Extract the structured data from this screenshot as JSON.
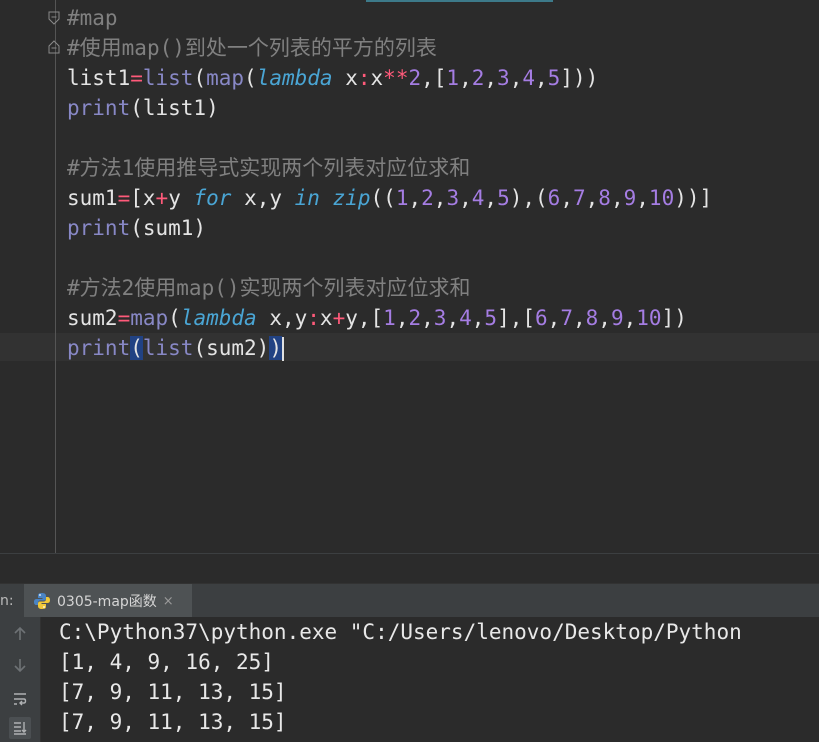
{
  "editor": {
    "code_lines": [
      [
        {
          "t": "#map",
          "c": "comment"
        }
      ],
      [
        {
          "t": "#使用",
          "c": "comment"
        },
        {
          "t": "map()",
          "c": "comment"
        },
        {
          "t": "到处一个列表的平方的列表",
          "c": "comment"
        }
      ],
      [
        {
          "t": "list1",
          "c": "plain"
        },
        {
          "t": "=",
          "c": "op"
        },
        {
          "t": "list",
          "c": "fn"
        },
        {
          "t": "(",
          "c": "plain"
        },
        {
          "t": "map",
          "c": "fn"
        },
        {
          "t": "(",
          "c": "plain"
        },
        {
          "t": "lambda",
          "c": "italic"
        },
        {
          "t": " x",
          "c": "plain"
        },
        {
          "t": ":",
          "c": "op"
        },
        {
          "t": "x",
          "c": "plain"
        },
        {
          "t": "**",
          "c": "op"
        },
        {
          "t": "2",
          "c": "num"
        },
        {
          "t": ",[",
          "c": "plain"
        },
        {
          "t": "1",
          "c": "num"
        },
        {
          "t": ",",
          "c": "plain"
        },
        {
          "t": "2",
          "c": "num"
        },
        {
          "t": ",",
          "c": "plain"
        },
        {
          "t": "3",
          "c": "num"
        },
        {
          "t": ",",
          "c": "plain"
        },
        {
          "t": "4",
          "c": "num"
        },
        {
          "t": ",",
          "c": "plain"
        },
        {
          "t": "5",
          "c": "num"
        },
        {
          "t": "]))",
          "c": "plain"
        }
      ],
      [
        {
          "t": "print",
          "c": "fn"
        },
        {
          "t": "(list1)",
          "c": "plain"
        }
      ],
      [],
      [
        {
          "t": "#方法1使用推导式实现两个列表对应位求和",
          "c": "comment"
        }
      ],
      [
        {
          "t": "sum1",
          "c": "plain"
        },
        {
          "t": "=",
          "c": "op"
        },
        {
          "t": "[x",
          "c": "plain"
        },
        {
          "t": "+",
          "c": "op"
        },
        {
          "t": "y ",
          "c": "plain"
        },
        {
          "t": "for",
          "c": "italic"
        },
        {
          "t": " x,y ",
          "c": "plain"
        },
        {
          "t": "in",
          "c": "italic"
        },
        {
          "t": " ",
          "c": "plain"
        },
        {
          "t": "zip",
          "c": "italic"
        },
        {
          "t": "((",
          "c": "plain"
        },
        {
          "t": "1",
          "c": "num"
        },
        {
          "t": ",",
          "c": "plain"
        },
        {
          "t": "2",
          "c": "num"
        },
        {
          "t": ",",
          "c": "plain"
        },
        {
          "t": "3",
          "c": "num"
        },
        {
          "t": ",",
          "c": "plain"
        },
        {
          "t": "4",
          "c": "num"
        },
        {
          "t": ",",
          "c": "plain"
        },
        {
          "t": "5",
          "c": "num"
        },
        {
          "t": "),(",
          "c": "plain"
        },
        {
          "t": "6",
          "c": "num"
        },
        {
          "t": ",",
          "c": "plain"
        },
        {
          "t": "7",
          "c": "num"
        },
        {
          "t": ",",
          "c": "plain"
        },
        {
          "t": "8",
          "c": "num"
        },
        {
          "t": ",",
          "c": "plain"
        },
        {
          "t": "9",
          "c": "num"
        },
        {
          "t": ",",
          "c": "plain"
        },
        {
          "t": "10",
          "c": "num"
        },
        {
          "t": "))]",
          "c": "plain"
        }
      ],
      [
        {
          "t": "print",
          "c": "fn"
        },
        {
          "t": "(sum1)",
          "c": "plain"
        }
      ],
      [],
      [
        {
          "t": "#方法2使用map()实现两个列表对应位求和",
          "c": "comment"
        }
      ],
      [
        {
          "t": "sum2",
          "c": "plain"
        },
        {
          "t": "=",
          "c": "op"
        },
        {
          "t": "map",
          "c": "fn"
        },
        {
          "t": "(",
          "c": "plain"
        },
        {
          "t": "lambda",
          "c": "italic"
        },
        {
          "t": " x,y",
          "c": "plain"
        },
        {
          "t": ":",
          "c": "op"
        },
        {
          "t": "x",
          "c": "plain"
        },
        {
          "t": "+",
          "c": "op"
        },
        {
          "t": "y,[",
          "c": "plain"
        },
        {
          "t": "1",
          "c": "num"
        },
        {
          "t": ",",
          "c": "plain"
        },
        {
          "t": "2",
          "c": "num"
        },
        {
          "t": ",",
          "c": "plain"
        },
        {
          "t": "3",
          "c": "num"
        },
        {
          "t": ",",
          "c": "plain"
        },
        {
          "t": "4",
          "c": "num"
        },
        {
          "t": ",",
          "c": "plain"
        },
        {
          "t": "5",
          "c": "num"
        },
        {
          "t": "],[",
          "c": "plain"
        },
        {
          "t": "6",
          "c": "num"
        },
        {
          "t": ",",
          "c": "plain"
        },
        {
          "t": "7",
          "c": "num"
        },
        {
          "t": ",",
          "c": "plain"
        },
        {
          "t": "8",
          "c": "num"
        },
        {
          "t": ",",
          "c": "plain"
        },
        {
          "t": "9",
          "c": "num"
        },
        {
          "t": ",",
          "c": "plain"
        },
        {
          "t": "10",
          "c": "num"
        },
        {
          "t": "])",
          "c": "plain"
        }
      ],
      [
        {
          "t": "print",
          "c": "fn"
        },
        {
          "t": "(",
          "c": "bracket"
        },
        {
          "t": "list",
          "c": "fn"
        },
        {
          "t": "(sum2)",
          "c": "plain"
        },
        {
          "t": ")",
          "c": "bracket"
        }
      ]
    ]
  },
  "run": {
    "prefix": "n:",
    "tab_label": "0305-map函数",
    "close_glyph": "×",
    "icon": "python-icon",
    "toolbar": [
      "up-arrow-icon",
      "down-arrow-icon",
      "soft-wrap-icon",
      "scroll-to-end-icon"
    ]
  },
  "console": {
    "lines": [
      "C:\\Python37\\python.exe \"C:/Users/lenovo/Desktop/Python",
      "[1, 4, 9, 16, 25]",
      "[7, 9, 11, 13, 15]",
      "[7, 9, 11, 13, 15]"
    ]
  }
}
